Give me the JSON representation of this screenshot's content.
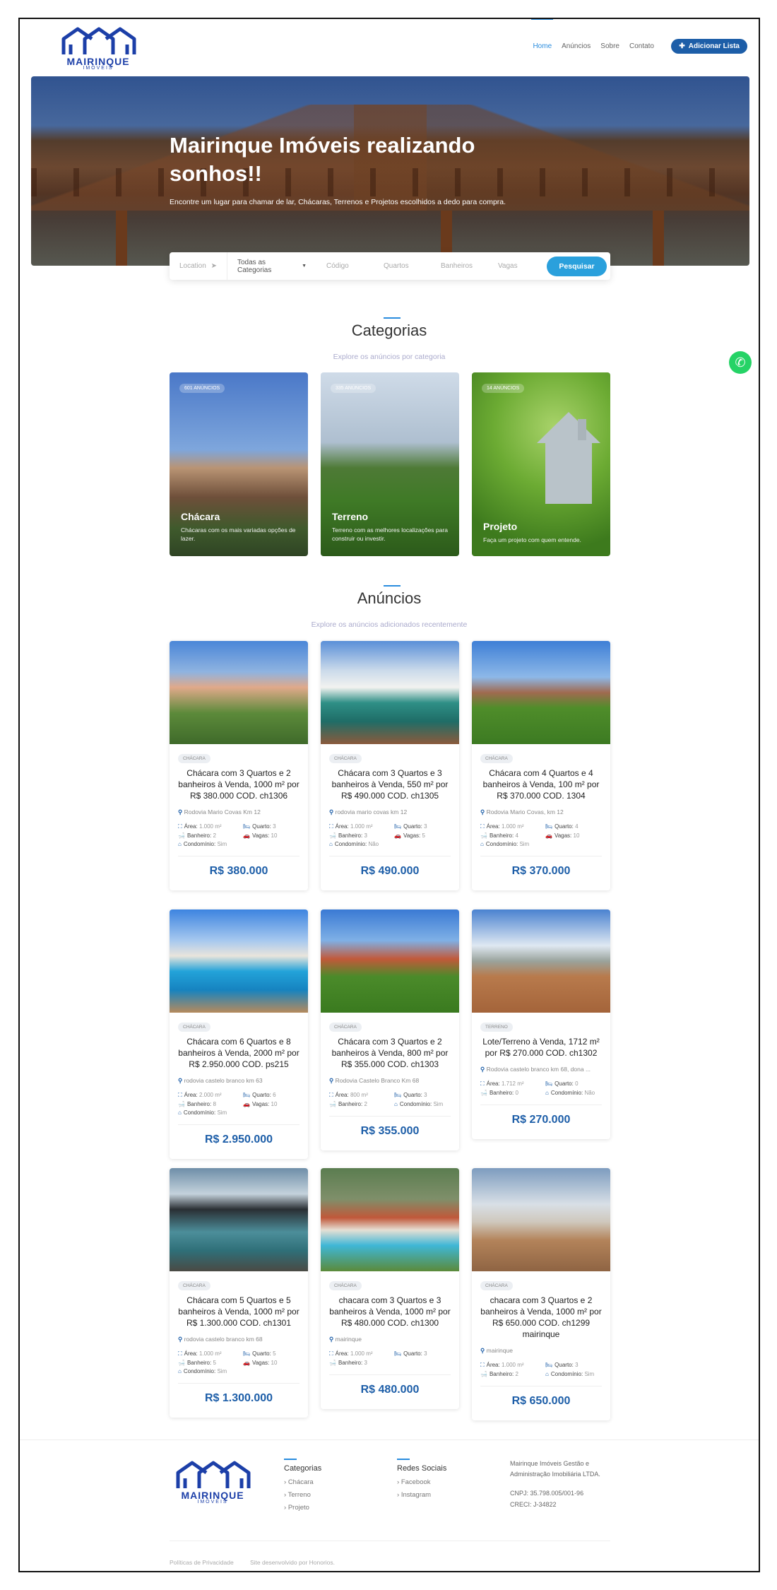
{
  "header": {
    "logo_text": "MAIRINQUE",
    "logo_sub": "IMÓVEIS",
    "nav": [
      "Home",
      "Anúncios",
      "Sobre",
      "Contato"
    ],
    "add_button": "Adicionar Lista"
  },
  "hero": {
    "title": "Mairinque Imóveis realizando sonhos!!",
    "subtitle": "Encontre um lugar para chamar de lar, Chácaras, Terrenos e Projetos escolhidos a dedo para compra."
  },
  "search": {
    "location_placeholder": "Location",
    "category": "Todas as Categorias",
    "codigo": "Código",
    "quartos": "Quartos",
    "banheiros": "Banheiros",
    "vagas": "Vagas",
    "button": "Pesquisar"
  },
  "categories": {
    "title": "Categorias",
    "subtitle": "Explore os anúncios por categoria",
    "items": [
      {
        "badge": "601 ANÚNCIOS",
        "name": "Chácara",
        "desc": "Chácaras com os mais variadas opções de lazer."
      },
      {
        "badge": "335 ANÚNCIOS",
        "name": "Terreno",
        "desc": "Terreno com as melhores localizações para construir ou investir."
      },
      {
        "badge": "14 ANÚNCIOS",
        "name": "Projeto",
        "desc": "Faça um projeto com quem entende."
      }
    ]
  },
  "listings": {
    "title": "Anúncios",
    "subtitle": "Explore os anúncios adicionados recentemente",
    "items": [
      {
        "badge": "Chácara",
        "title": "Chácara com 3 Quartos e 2 banheiros à Venda, 1000 m² por R$ 380.000 COD. ch1306",
        "location": "Rodovia Mario Covas Km 12",
        "area": "1.000 m²",
        "quarto": "3",
        "banheiro": "2",
        "vagas": "10",
        "condominio": "Sim",
        "price": "R$ 380.000"
      },
      {
        "badge": "Chácara",
        "title": "Chácara com 3 Quartos e 3 banheiros à Venda, 550 m² por R$ 490.000 COD. ch1305",
        "location": "rodovia mario covas km 12",
        "area": "1.000 m²",
        "quarto": "3",
        "banheiro": "3",
        "vagas": "5",
        "condominio": "Não",
        "price": "R$ 490.000"
      },
      {
        "badge": "Chácara",
        "title": "Chácara com 4 Quartos e 4 banheiros à Venda, 100 m² por R$ 370.000 COD. 1304",
        "location": "Rodovia Mario Covas, km 12",
        "area": "1.000 m²",
        "quarto": "4",
        "banheiro": "4",
        "vagas": "10",
        "condominio": "Sim",
        "price": "R$ 370.000"
      },
      {
        "badge": "Chácara",
        "title": "Chácara com 6 Quartos e 8 banheiros à Venda, 2000 m² por R$ 2.950.000 COD. ps215",
        "location": "rodovia castelo branco km 63",
        "area": "2.000 m²",
        "quarto": "6",
        "banheiro": "8",
        "vagas": "10",
        "condominio": "Sim",
        "price": "R$ 2.950.000"
      },
      {
        "badge": "Chácara",
        "title": "Chácara com 3 Quartos e 2 banheiros à Venda, 800 m² por R$ 355.000 COD. ch1303",
        "location": "Rodovia Castelo Branco Km 68",
        "area": "800 m²",
        "quarto": "3",
        "banheiro": "2",
        "vagas": "",
        "condominio": "Sim",
        "price": "R$ 355.000"
      },
      {
        "badge": "Terreno",
        "title": "Lote/Terreno à Venda, 1712 m² por R$ 270.000 COD. ch1302",
        "location": "Rodovia castelo branco km 68, dona ...",
        "area": "1.712 m²",
        "quarto": "0",
        "banheiro": "0",
        "vagas": "",
        "condominio": "Não",
        "price": "R$ 270.000"
      },
      {
        "badge": "Chácara",
        "title": "Chácara com 5 Quartos e 5 banheiros à Venda, 1000 m² por R$ 1.300.000 COD. ch1301",
        "location": "rodovia castelo branco km 68",
        "area": "1.000 m²",
        "quarto": "5",
        "banheiro": "5",
        "vagas": "10",
        "condominio": "Sim",
        "price": "R$ 1.300.000"
      },
      {
        "badge": "Chácara",
        "title": "chacara com 3 Quartos e 3 banheiros à Venda, 1000 m² por R$ 480.000 COD. ch1300",
        "location": "mairinque",
        "area": "1.000 m²",
        "quarto": "3",
        "banheiro": "3",
        "vagas": "",
        "condominio": "",
        "price": "R$ 480.000"
      },
      {
        "badge": "Chácara",
        "title": "chacara com 3 Quartos e 2 banheiros à Venda, 1000 m² por R$ 650.000 COD. ch1299 mairinque",
        "location": "mairinque",
        "area": "1.000 m²",
        "quarto": "3",
        "banheiro": "2",
        "vagas": "",
        "condominio": "Sim",
        "price": "R$ 650.000"
      }
    ]
  },
  "labels": {
    "area": "Área:",
    "quarto": "Quarto:",
    "banheiro": "Banheiro:",
    "vagas": "Vagas:",
    "condominio": "Condomínio:"
  },
  "footer": {
    "categorias_title": "Categorias",
    "categorias": [
      "Chácara",
      "Terreno",
      "Projeto"
    ],
    "redes_title": "Redes Sociais",
    "redes": [
      "Facebook",
      "Instagram"
    ],
    "company": "Mairinque Imóveis Gestão e Administração Imobiliária LTDA.",
    "cnpj": "CNPJ: 35.798.005/001-96",
    "creci": "CRECI: J-34822",
    "privacy": "Políticas de Privacidade",
    "credit": "Site desenvolvido por Honorios."
  },
  "colors": {
    "primary": "#1d5ea8",
    "accent": "#2a8cde",
    "whatsapp": "#25d366"
  }
}
